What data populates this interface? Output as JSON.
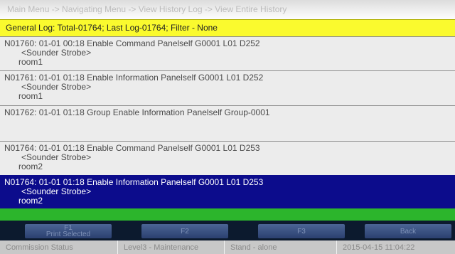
{
  "breadcrumb": "Main Menu -> Navigating Menu -> View History Log -> View Entire History",
  "log_header": "General Log: Total-01764; Last Log-01764; Filter - None",
  "entries": [
    {
      "line1": "N01760: 01-01 00:18 Enable Command Panelself G0001 L01 D252",
      "line2": "<Sounder Strobe>",
      "line3": "room1"
    },
    {
      "line1": "N01761: 01-01 01:18 Enable Information Panelself G0001 L01 D252",
      "line2": "<Sounder Strobe>",
      "line3": "room1"
    },
    {
      "line1": "N01762: 01-01 01:18 Group Enable Information Panelself Group-0001",
      "line2": "",
      "line3": ""
    },
    {
      "line1": "N01764: 01-01 01:18 Enable Command Panelself G0001 L01 D253",
      "line2": "<Sounder Strobe>",
      "line3": "room2"
    },
    {
      "line1": "N01764: 01-01 01:18 Enable Information Panelself G0001 L01 D253",
      "line2": "<Sounder Strobe>",
      "line3": "room2"
    }
  ],
  "function_keys": {
    "f1_top": "F1",
    "f1_bottom": "Print Selected",
    "f2": "F2",
    "f3": "F3",
    "back": "Back"
  },
  "status": {
    "mode": "Commission Status",
    "access_level": "Level3 - Maintenance",
    "network": "Stand - alone",
    "datetime": "2015-04-15 11:04:22"
  },
  "colors": {
    "header_yellow": "#fafa2e",
    "selection_blue": "#0c0c8c",
    "status_green": "#2cb52c"
  }
}
